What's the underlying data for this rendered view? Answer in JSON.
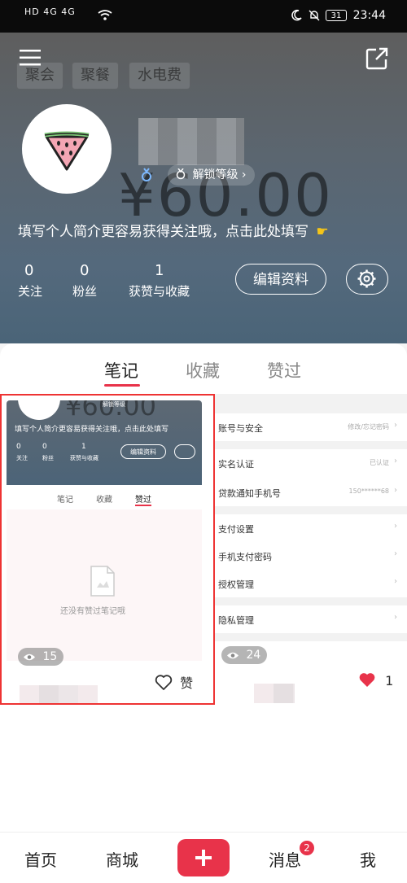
{
  "status_bar": {
    "left_labels": "HD 4G 4G",
    "battery": "31",
    "time": "23:44"
  },
  "header": {
    "tags": [
      "聚会",
      "聚餐",
      "水电费"
    ],
    "ghost_amount": "¥60.00",
    "unlock_level_label": "解锁等级",
    "bio_prompt": "填写个人简介更容易获得关注哦，点击此处填写",
    "stats": [
      {
        "value": "0",
        "label": "关注"
      },
      {
        "value": "0",
        "label": "粉丝"
      },
      {
        "value": "1",
        "label": "获赞与收藏"
      }
    ],
    "edit_profile_label": "编辑资料"
  },
  "tabs": [
    {
      "label": "笔记",
      "active": true
    },
    {
      "label": "收藏",
      "active": false
    },
    {
      "label": "赞过",
      "active": false
    }
  ],
  "notes": [
    {
      "views": "15",
      "like_label": "赞",
      "preview": {
        "amount": "¥60.00",
        "level": "解锁等级",
        "bio": "填写个人简介更容易获得关注哦，点击此处填写",
        "stats": [
          {
            "value": "0",
            "label": "关注"
          },
          {
            "value": "0",
            "label": "粉丝"
          },
          {
            "value": "1",
            "label": "获赞与收藏"
          }
        ],
        "edit": "编辑资料",
        "tabs": [
          "笔记",
          "收藏",
          "赞过"
        ],
        "empty_text": "还没有赞过笔记哦"
      }
    },
    {
      "views": "24",
      "like_count": "1",
      "preview": {
        "settings": [
          {
            "label": "账号与安全",
            "value": "修改/忘记密码"
          },
          {
            "label": "实名认证",
            "value": "已认证"
          },
          {
            "label": "贷款通知手机号",
            "value": "150******68"
          },
          {
            "label": "支付设置",
            "value": ""
          },
          {
            "label": "手机支付密码",
            "value": ""
          },
          {
            "label": "授权管理",
            "value": ""
          },
          {
            "label": "隐私管理",
            "value": ""
          }
        ]
      }
    }
  ],
  "bottom_nav": {
    "home": "首页",
    "mall": "商城",
    "messages": "消息",
    "messages_badge": "2",
    "me": "我"
  },
  "colors": {
    "accent": "#e8334a",
    "header_top": "#5e5e5e",
    "header_bottom": "#4a6478"
  }
}
